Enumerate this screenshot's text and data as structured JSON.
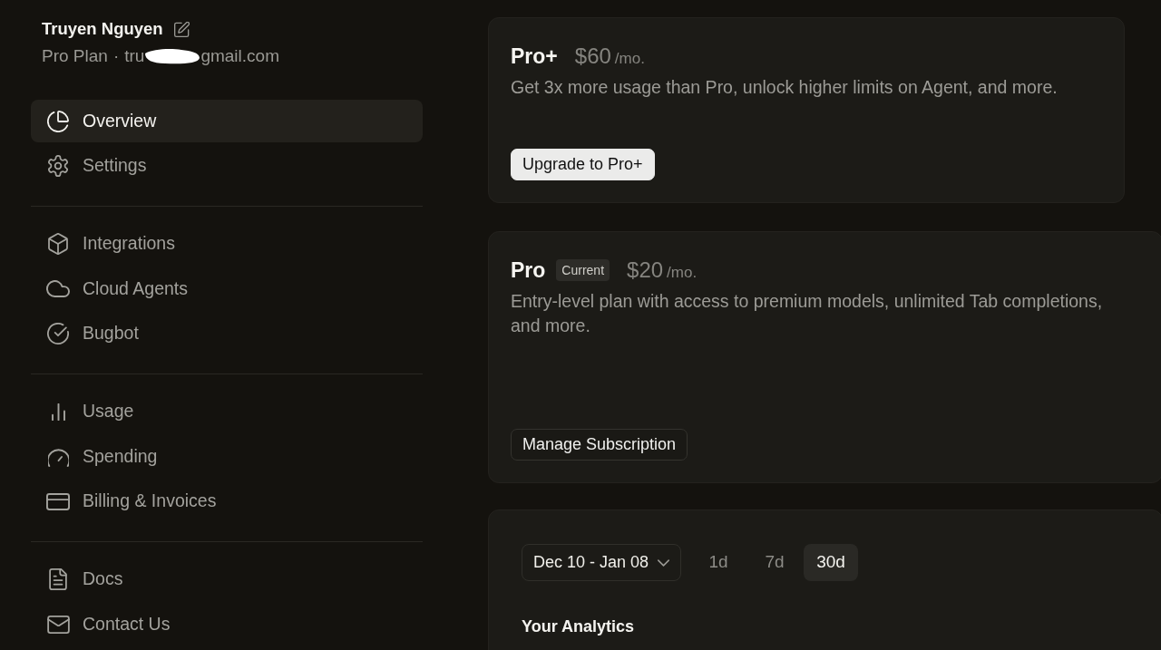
{
  "profile": {
    "name": "Truyen Nguyen",
    "plan": "Pro Plan",
    "separator": "·",
    "email_start": "tru",
    "email_end": "gmail.com",
    "redacted": true
  },
  "sidebar": {
    "sections": [
      {
        "items": [
          {
            "label": "Overview",
            "selected": true
          },
          {
            "label": "Settings",
            "selected": false
          }
        ]
      },
      {
        "items": [
          {
            "label": "Integrations",
            "selected": false
          },
          {
            "label": "Cloud Agents",
            "selected": false
          },
          {
            "label": "Bugbot",
            "selected": false
          }
        ]
      },
      {
        "items": [
          {
            "label": "Usage",
            "selected": false
          },
          {
            "label": "Spending",
            "selected": false
          },
          {
            "label": "Billing & Invoices",
            "selected": false
          }
        ]
      },
      {
        "items": [
          {
            "label": "Docs",
            "selected": false
          },
          {
            "label": "Contact Us",
            "selected": false
          }
        ]
      }
    ]
  },
  "plans": [
    {
      "name": "Pro+",
      "price": "$60",
      "period": "/mo.",
      "description": "Get 3x more usage than Pro, unlock higher limits on Agent, and more.",
      "button": {
        "label": "Upgrade to Pro+",
        "kind": "primary"
      }
    },
    {
      "name": "Pro",
      "badge": "Current",
      "price": "$20",
      "period": "/mo.",
      "description": "Entry-level plan with access to premium models, unlimited Tab completions, and more.",
      "button": {
        "label": "Manage Subscription",
        "kind": "outline"
      }
    }
  ],
  "analytics": {
    "date_range": "Dec 10 - Jan 08",
    "ranges": [
      {
        "label": "1d",
        "selected": false
      },
      {
        "label": "7d",
        "selected": false
      },
      {
        "label": "30d",
        "selected": true
      }
    ],
    "title": "Your Analytics"
  }
}
